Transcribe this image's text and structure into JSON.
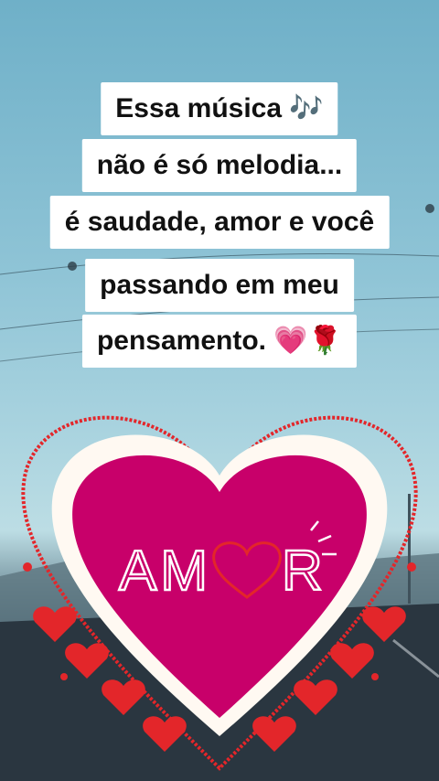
{
  "caption": {
    "line1": "Essa música 🎶",
    "line2": "não é só melodia...",
    "line3": "é saudade, amor e você",
    "line4": "passando em meu",
    "line5": "pensamento. 💗🌹"
  },
  "sticker": {
    "word_left": "AM",
    "word_right": "R",
    "icon": "heart-icon"
  },
  "colors": {
    "heart_fill": "#c8006a",
    "heart_outline": "#e3262a",
    "sky_top": "#6fb0c8",
    "caption_bg": "#ffffff"
  }
}
